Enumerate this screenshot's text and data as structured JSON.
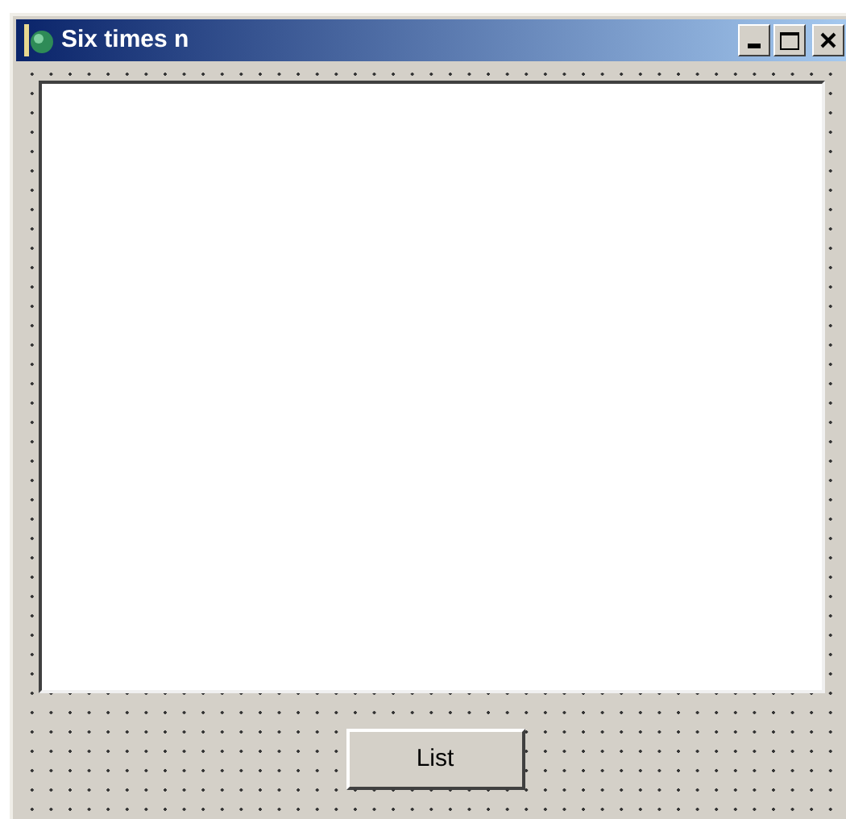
{
  "window": {
    "title": "Six times n"
  },
  "buttons": [
    {
      "label": "List"
    }
  ]
}
